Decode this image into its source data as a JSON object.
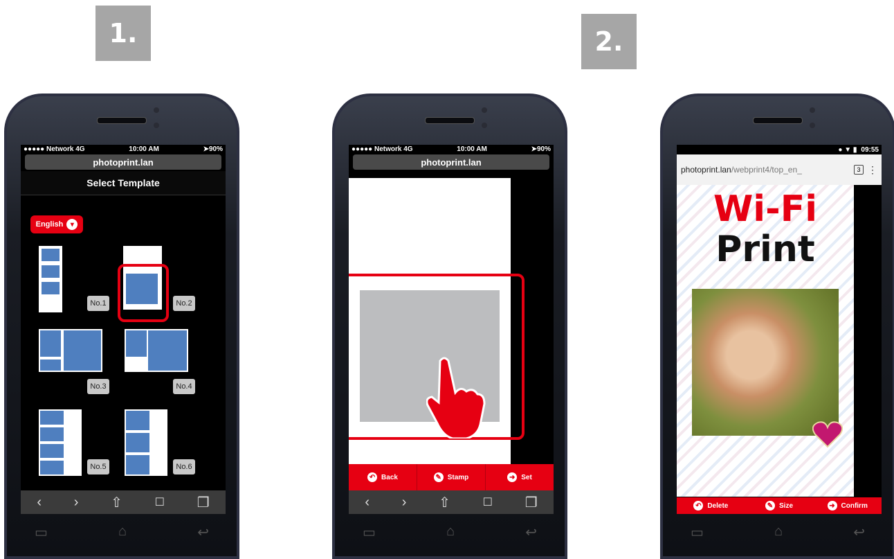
{
  "steps": {
    "step1": "1.",
    "step2": "2."
  },
  "phone1": {
    "status": {
      "carrier": "●●●●● Network 4G",
      "time": "10:00 AM",
      "battery": "➤90%"
    },
    "url": "photoprint.lan",
    "header_title": "Select Template",
    "language": "English",
    "templates": [
      "No.1",
      "No.2",
      "No.3",
      "No.4",
      "No.5",
      "No.6"
    ],
    "selected_template": "No.2"
  },
  "phone2": {
    "status": {
      "carrier": "●●●●● Network 4G",
      "time": "10:00 AM",
      "battery": "➤90%"
    },
    "url": "photoprint.lan",
    "buttons": {
      "back": "Back",
      "stamp": "Stamp",
      "set": "Set"
    }
  },
  "phone3": {
    "status": {
      "time": "09:55"
    },
    "url_host": "photoprint.lan",
    "url_path": "/webprint4/top_en_",
    "tab_count": "3",
    "title_line1": "Wi-Fi",
    "title_line2": "Print",
    "buttons": {
      "delete": "Delete",
      "size": "Size",
      "confirm": "Confirm"
    }
  },
  "ios_toolbar": {
    "back": "‹",
    "forward": "›",
    "share": "⇧",
    "bookmarks": "📖",
    "tabs": "❐"
  },
  "colors": {
    "accent_red": "#e60012",
    "template_blue": "#4f7fbf",
    "badge_gray": "#a6a6a6"
  }
}
